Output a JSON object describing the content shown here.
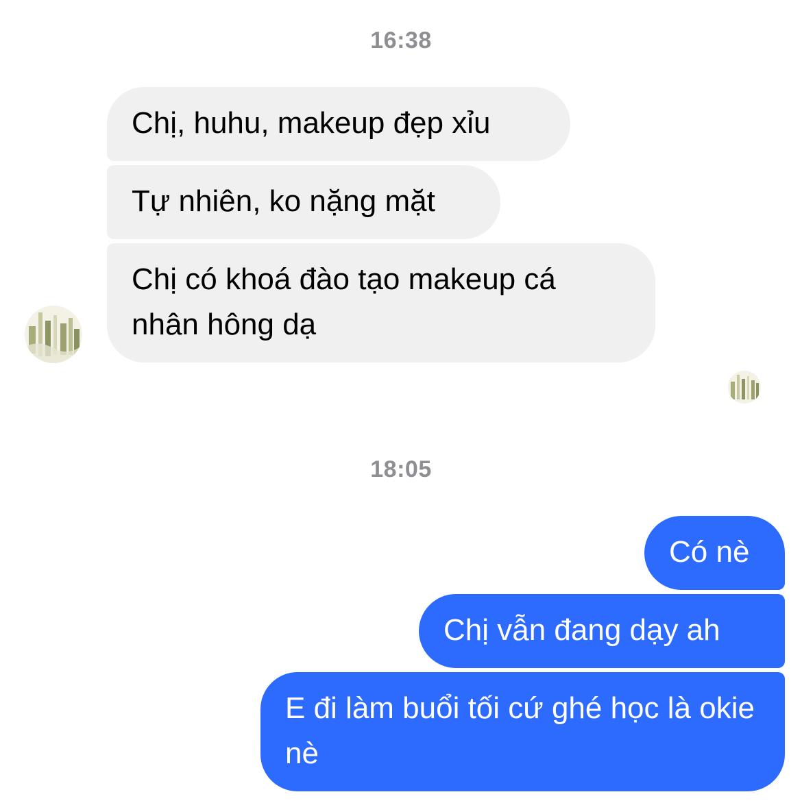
{
  "conversation": {
    "timestamp_1": "16:38",
    "incoming": [
      {
        "text": "Chị, huhu, makeup đẹp xỉu"
      },
      {
        "text": "Tự nhiên, ko nặng mặt"
      },
      {
        "text": "Chị có khoá đào tạo makeup cá nhân hông dạ"
      }
    ],
    "timestamp_2": "18:05",
    "outgoing": [
      {
        "text": "Có nè"
      },
      {
        "text": "Chị vẫn đang dạy ah"
      },
      {
        "text": "E đi làm buổi tối cứ ghé học là okie nè"
      }
    ]
  },
  "colors": {
    "incoming_bubble": "#f0f0f0",
    "outgoing_bubble": "#2c6bfe",
    "timestamp_text": "#8e8e93"
  }
}
